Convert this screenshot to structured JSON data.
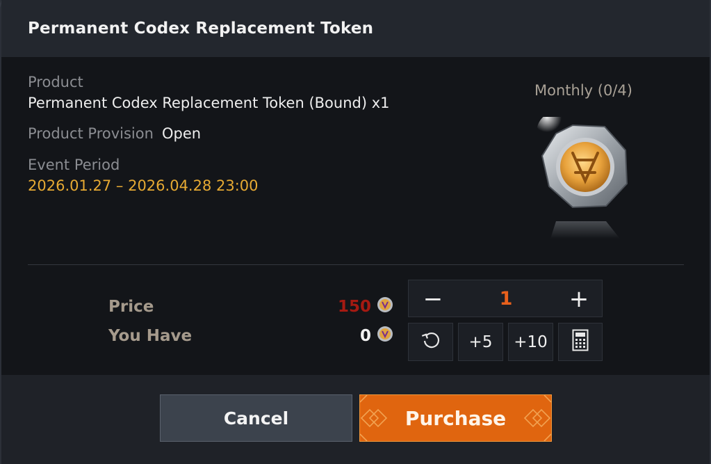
{
  "dialog": {
    "title": "Permanent Codex Replacement Token"
  },
  "product": {
    "product_label": "Product",
    "product_value": "Permanent Codex Replacement Token (Bound) x1",
    "provision_label": "Product Provision",
    "provision_value": "Open",
    "event_label": "Event Period",
    "event_value": "2026.01.27 – 2026.04.28 23:00",
    "limit_text": "Monthly (0/4)",
    "image_icon": "token-coin-icon"
  },
  "purchase": {
    "price_label": "Price",
    "price_value": "150",
    "have_label": "You Have",
    "have_value": "0",
    "currency_icon": "currency-coin-icon",
    "quantity": "1",
    "decrease_symbol": "−",
    "increase_symbol": "+",
    "plus5_label": "+5",
    "plus10_label": "+10"
  },
  "buttons": {
    "cancel_label": "Cancel",
    "purchase_label": "Purchase"
  },
  "colors": {
    "accent": "#e0650f",
    "event_text": "#e7aa33",
    "price_text": "#a51a12",
    "quantity_text": "#e8601c"
  }
}
